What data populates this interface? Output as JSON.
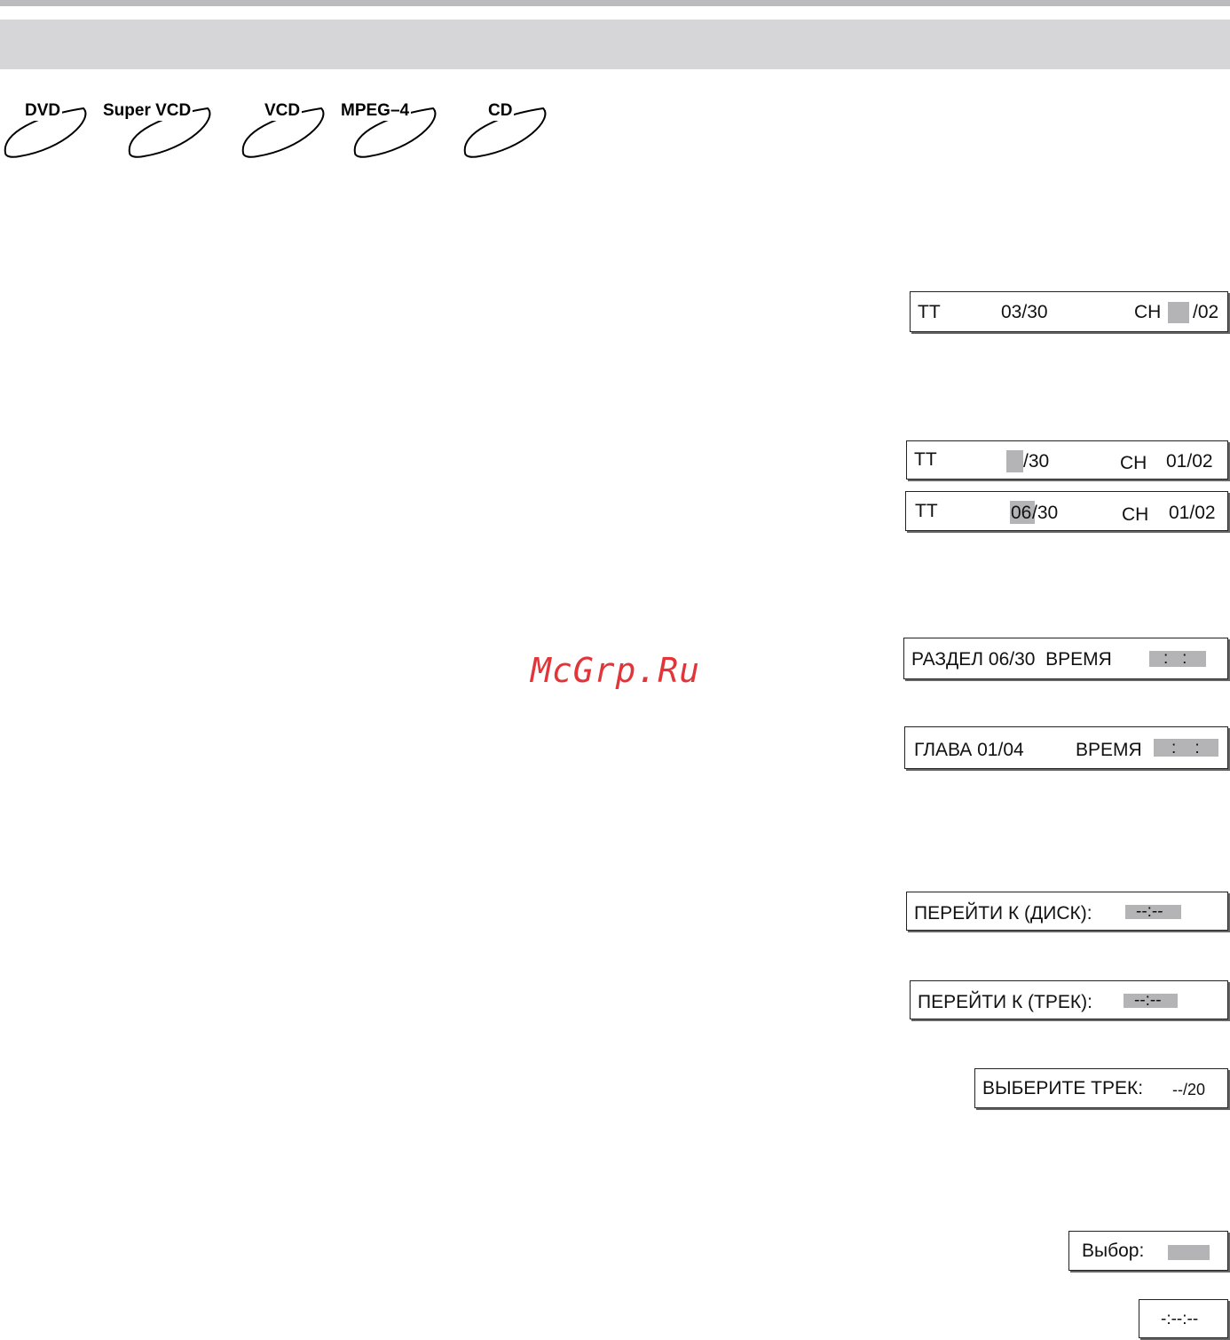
{
  "header": {
    "band_color": "#d6d6d8",
    "rule_color": "#bcbcbe"
  },
  "disc_logos": [
    "DVD",
    "Super VCD",
    "VCD",
    "MPEG–4",
    "CD"
  ],
  "osd": {
    "title_chapter_1": {
      "tt_label": "TT",
      "tt_value": "03/30",
      "ch_label": "CH",
      "ch_value": "/02"
    },
    "title_chapter_2": {
      "tt_label": "TT",
      "tt_value": "/30",
      "ch_label": "CH",
      "ch_value": "01/02"
    },
    "title_chapter_3": {
      "tt_label": "TT",
      "tt_highlight": "06",
      "tt_value": "/30",
      "ch_label": "CH",
      "ch_value": "01/02"
    },
    "razdel_time": {
      "label": "РАЗДЕЛ 06/30  ВРЕМЯ",
      "field": ":   :"
    },
    "glava_time": {
      "label": "ГЛАВА 01/04",
      "time_label": "ВРЕМЯ",
      "field": ":    :"
    },
    "goto_disc": {
      "label": "ПЕРЕЙТИ К (ДИСК):",
      "field": "--:--"
    },
    "goto_track": {
      "label": "ПЕРЕЙТИ К (ТРЕК):",
      "field": "--:--"
    },
    "select_track": {
      "label": "ВЫБЕРИТЕ ТРЕК:",
      "value": "--/20"
    },
    "choice": {
      "label": "Выбор:"
    },
    "time_blank": {
      "value": "-:--:--"
    }
  },
  "watermark": {
    "text": "McGrp.Ru",
    "color": "#e2353a"
  },
  "highlight_color": "#b4b4b6"
}
